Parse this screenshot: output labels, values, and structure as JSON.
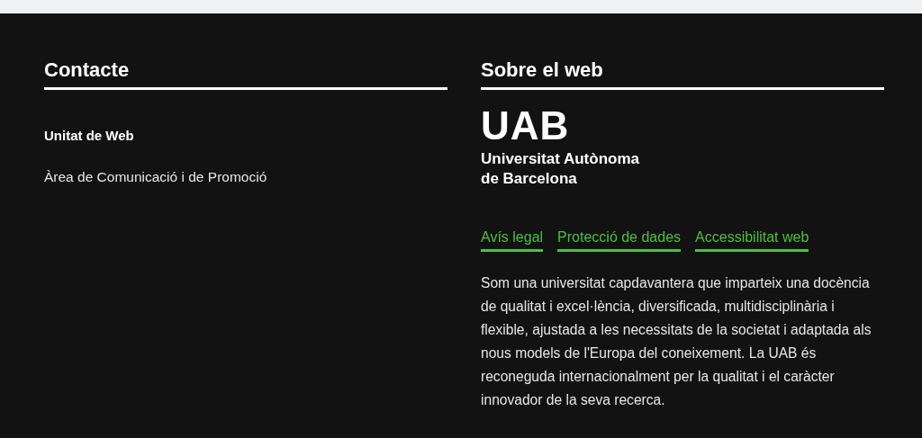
{
  "contact": {
    "heading": "Contacte",
    "unit": "Unitat de Web",
    "area": "Àrea de Comunicació i de Promoció"
  },
  "about": {
    "heading": "Sobre el web",
    "logo": {
      "mark": "UAB",
      "name_line_1": "Universitat Autònoma",
      "name_line_2": "de Barcelona"
    },
    "links": [
      "Avís legal",
      "Protecció de dades",
      "Accessibilitat web"
    ],
    "description": "Som una universitat capdavantera que imparteix una docència de qualitat i excel·lència, diversificada, multidisciplinària i flexible, ajustada a les necessitats de la societat i adaptada als nous models de l'Europa del coneixement. La UAB és reconeguda internacionalment per la qualitat i el caràcter innovador de la seva recerca."
  }
}
